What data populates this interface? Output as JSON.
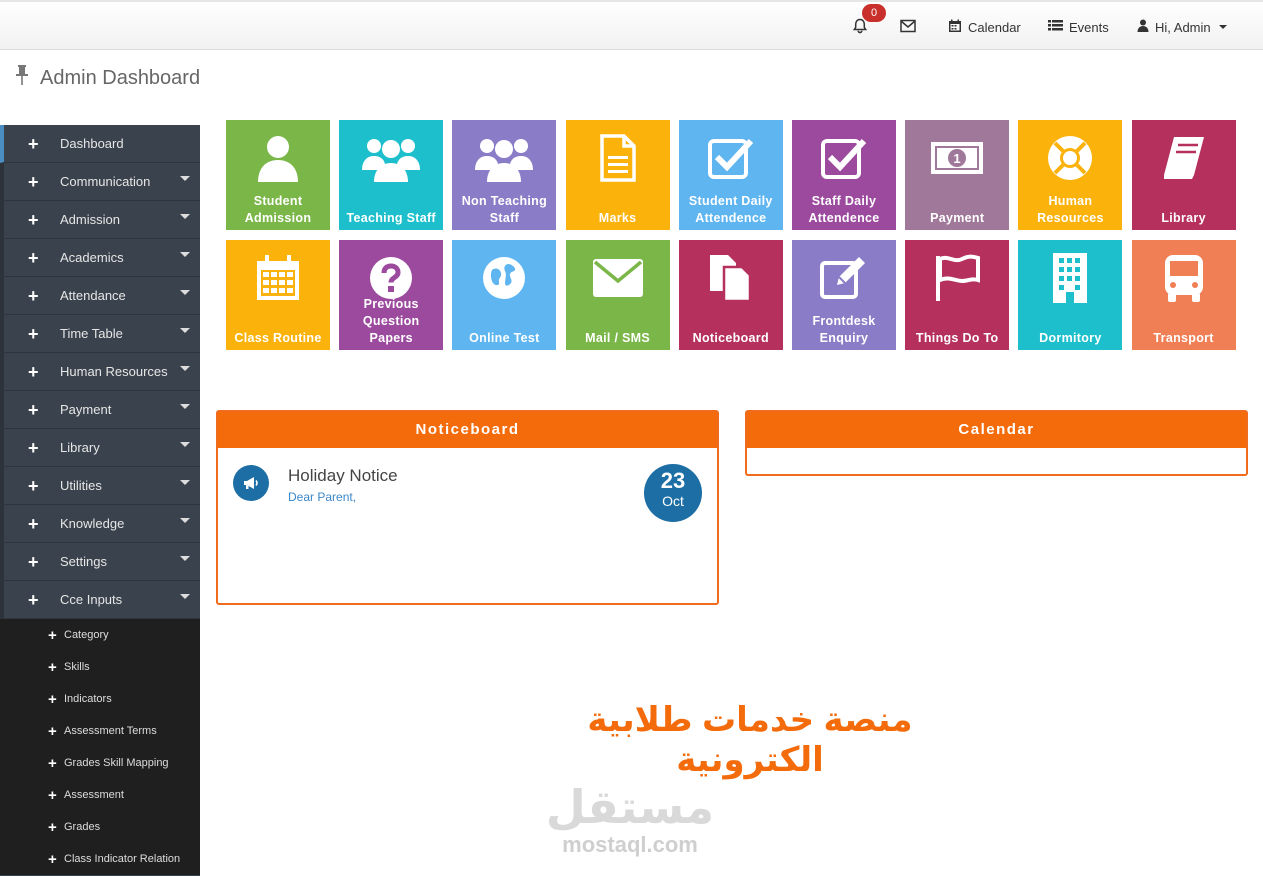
{
  "header": {
    "notification_count": "0",
    "calendar_label": "Calendar",
    "events_label": "Events",
    "user_label": "Hi, Admin"
  },
  "page": {
    "title": "Admin Dashboard"
  },
  "sidebar": {
    "items": [
      {
        "label": "Dashboard"
      },
      {
        "label": "Communication"
      },
      {
        "label": "Admission"
      },
      {
        "label": "Academics"
      },
      {
        "label": "Attendance"
      },
      {
        "label": "Time Table"
      },
      {
        "label": "Human Resources"
      },
      {
        "label": "Payment"
      },
      {
        "label": "Library"
      },
      {
        "label": "Utilities"
      },
      {
        "label": "Knowledge"
      },
      {
        "label": "Settings"
      },
      {
        "label": "Cce Inputs"
      }
    ],
    "subitems": [
      {
        "label": "Category"
      },
      {
        "label": "Skills"
      },
      {
        "label": "Indicators"
      },
      {
        "label": "Assessment Terms"
      },
      {
        "label": "Grades Skill Mapping"
      },
      {
        "label": "Assessment"
      },
      {
        "label": "Grades"
      },
      {
        "label": "Class Indicator Relation"
      }
    ]
  },
  "tiles": [
    {
      "label": "Student Admission",
      "icon": "user-icon",
      "color": "#7ab648"
    },
    {
      "label": "Teaching Staff",
      "icon": "users-icon",
      "color": "#1cbfcb"
    },
    {
      "label": "Non Teaching Staff",
      "icon": "users-icon",
      "color": "#8b7cc7"
    },
    {
      "label": "Marks",
      "icon": "document-icon",
      "color": "#fbb20a"
    },
    {
      "label": "Student Daily Attendence",
      "icon": "checkbox-icon",
      "color": "#5eb5f0"
    },
    {
      "label": "Staff Daily Attendence",
      "icon": "checkbox-icon",
      "color": "#9b4a9e"
    },
    {
      "label": "Payment",
      "icon": "money-icon",
      "color": "#a0789a"
    },
    {
      "label": "Human Resources",
      "icon": "lifebuoy-icon",
      "color": "#fbb20a"
    },
    {
      "label": "Library",
      "icon": "book-icon",
      "color": "#b5305c"
    },
    {
      "label": "Class Routine",
      "icon": "calendar-icon",
      "color": "#fbb20a"
    },
    {
      "label": "Previous Question Papers",
      "icon": "question-icon",
      "color": "#9b4a9e"
    },
    {
      "label": "Online Test",
      "icon": "globe-icon",
      "color": "#5eb5f0"
    },
    {
      "label": "Mail / SMS",
      "icon": "envelope-icon",
      "color": "#7ab648"
    },
    {
      "label": "Noticeboard",
      "icon": "files-icon",
      "color": "#b5305c"
    },
    {
      "label": "Frontdesk Enquiry",
      "icon": "edit-icon",
      "color": "#8b7cc7"
    },
    {
      "label": "Things Do To",
      "icon": "flag-icon",
      "color": "#b5305c"
    },
    {
      "label": "Dormitory",
      "icon": "building-icon",
      "color": "#1cbfcb"
    },
    {
      "label": "Transport",
      "icon": "bus-icon",
      "color": "#f07f55"
    }
  ],
  "noticeboard": {
    "title": "Noticeboard",
    "notice_title": "Holiday Notice",
    "notice_text": "Dear Parent,",
    "day": "23",
    "month": "Oct"
  },
  "calendar_panel": {
    "title": "Calendar"
  },
  "banner": {
    "text": "منصة خدمات طلابية الكترونية"
  },
  "watermark": {
    "arabic": "مستقل",
    "latin": "mostaql.com"
  }
}
